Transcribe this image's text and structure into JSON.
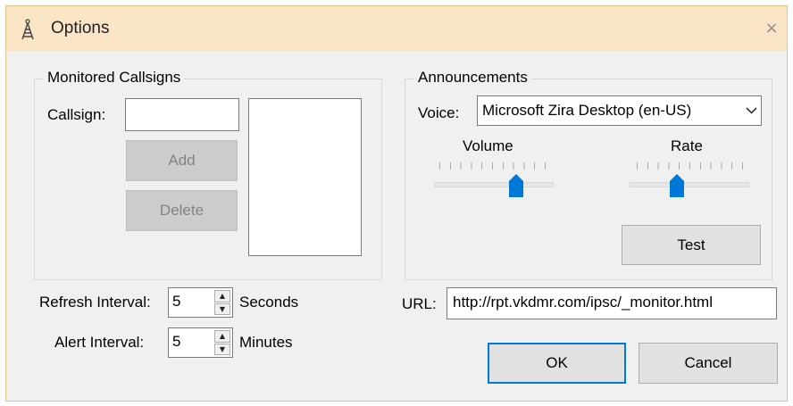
{
  "window": {
    "title": "Options",
    "close_label": "×"
  },
  "monitored": {
    "legend": "Monitored Callsigns",
    "callsign_label": "Callsign:",
    "callsign_value": "",
    "add_label": "Add",
    "delete_label": "Delete",
    "list_items": []
  },
  "announcements": {
    "legend": "Announcements",
    "voice_label": "Voice:",
    "voice_value": "Microsoft Zira Desktop (en-US)",
    "volume_label": "Volume",
    "rate_label": "Rate",
    "volume_level": 0.7,
    "rate_level": 0.4,
    "test_label": "Test"
  },
  "intervals": {
    "refresh_label": "Refresh Interval:",
    "refresh_value": "5",
    "refresh_unit": "Seconds",
    "alert_label": "Alert Interval:",
    "alert_value": "5",
    "alert_unit": "Minutes"
  },
  "url": {
    "label": "URL:",
    "value": "http://rpt.vkdmr.com/ipsc/_monitor.html"
  },
  "footer": {
    "ok_label": "OK",
    "cancel_label": "Cancel"
  },
  "colors": {
    "accent": "#0078d7",
    "titlebar": "#fae6c6"
  }
}
